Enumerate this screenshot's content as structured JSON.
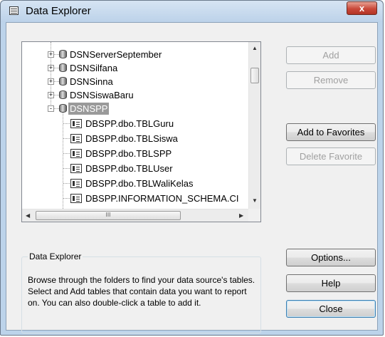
{
  "window": {
    "title": "Data Explorer",
    "close_label": "x"
  },
  "tree": {
    "top_nodes": [
      {
        "label": "DSNServerSeptember"
      },
      {
        "label": "DSNSilfana"
      },
      {
        "label": "DSNSinna"
      },
      {
        "label": "DSNSiswaBaru"
      }
    ],
    "selected_node": {
      "label": "DSNSPP",
      "expander": "-"
    },
    "children": [
      {
        "label": "DBSPP.dbo.TBLGuru"
      },
      {
        "label": "DBSPP.dbo.TBLSiswa"
      },
      {
        "label": "DBSPP.dbo.TBLSPP"
      },
      {
        "label": "DBSPP.dbo.TBLUser"
      },
      {
        "label": "DBSPP.dbo.TBLWaliKelas"
      },
      {
        "label": "DBSPP.INFORMATION_SCHEMA.CI"
      }
    ],
    "collapsed_expander": "+",
    "hscroll_grip": "III"
  },
  "buttons": {
    "add": "Add",
    "remove": "Remove",
    "add_favorites": "Add to Favorites",
    "delete_favorite": "Delete Favorite",
    "options": "Options...",
    "help": "Help",
    "close": "Close"
  },
  "groupbox": {
    "title": "Data Explorer",
    "text": "Browse through the folders to find your data source's tables.  Select and Add tables that contain data you want to report on.  You can also double-click a table to add it."
  },
  "icons": {
    "database": "database-icon",
    "table": "table-icon",
    "dialog": "dialog-icon"
  }
}
